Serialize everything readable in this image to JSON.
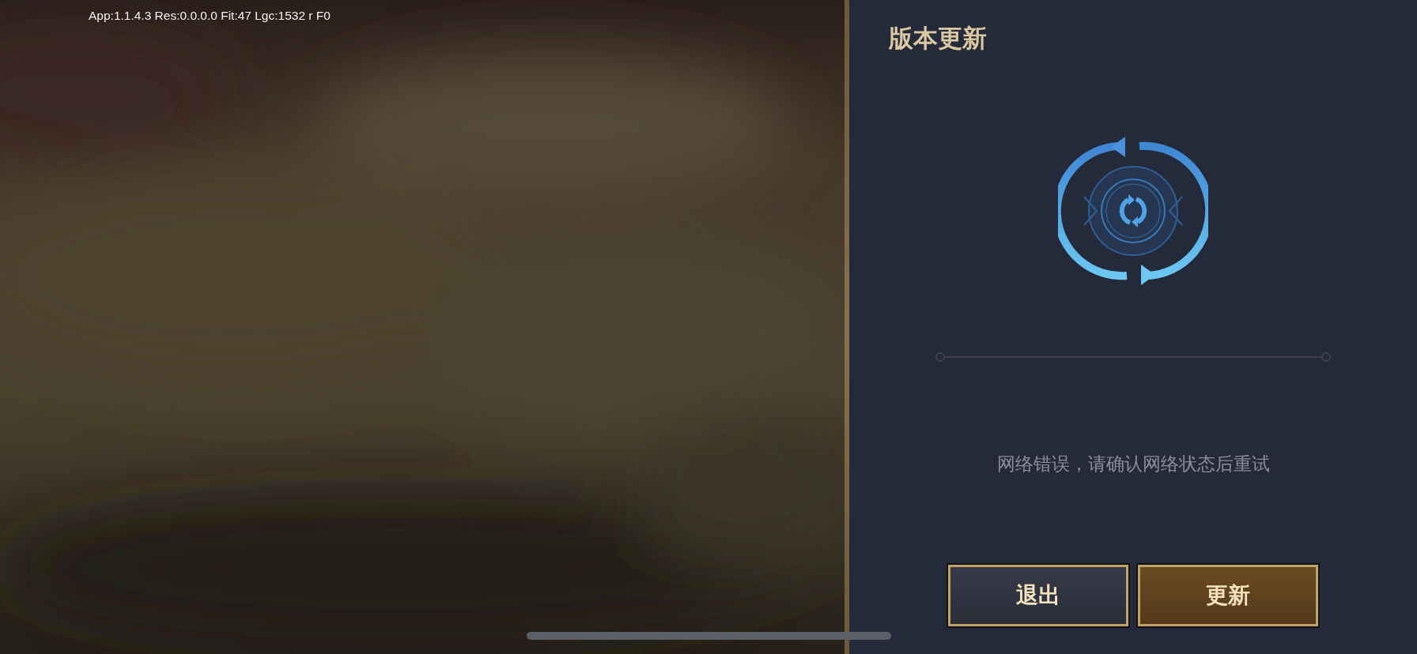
{
  "debug_overlay": {
    "text": "App:1.1.4.3 Res:0.0.0.0 Fit:47 Lgc:1532 r F0"
  },
  "update_panel": {
    "title": "版本更新",
    "progress": {
      "level": 0
    },
    "message": "网络错误，请确认网络状态后重试",
    "buttons": [
      {
        "label": "退出",
        "kind": "secondary"
      },
      {
        "label": "更新",
        "kind": "primary"
      }
    ]
  }
}
